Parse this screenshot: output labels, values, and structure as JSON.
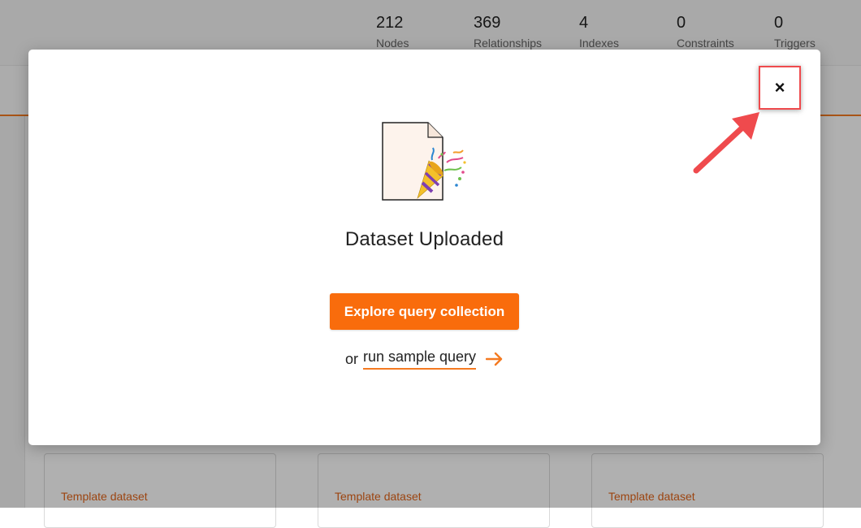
{
  "header": {
    "stats": [
      {
        "value": "212",
        "label": "Nodes"
      },
      {
        "value": "369",
        "label": "Relationships"
      },
      {
        "value": "4",
        "label": "Indexes"
      },
      {
        "value": "0",
        "label": "Constraints"
      },
      {
        "value": "0",
        "label": "Triggers"
      }
    ]
  },
  "cards": [
    {
      "label": "Template dataset"
    },
    {
      "label": "Template dataset"
    },
    {
      "label": "Template dataset"
    }
  ],
  "modal": {
    "close_label": "×",
    "title": "Dataset Uploaded",
    "cta_label": "Explore query collection",
    "or_text": "or",
    "sample_link": "run sample query"
  },
  "colors": {
    "accent": "#f96c0c",
    "annotation": "#ef4a4d"
  },
  "icons": {
    "file": "file-party-popper-icon",
    "close": "close-icon",
    "arrow": "arrow-right-icon"
  }
}
